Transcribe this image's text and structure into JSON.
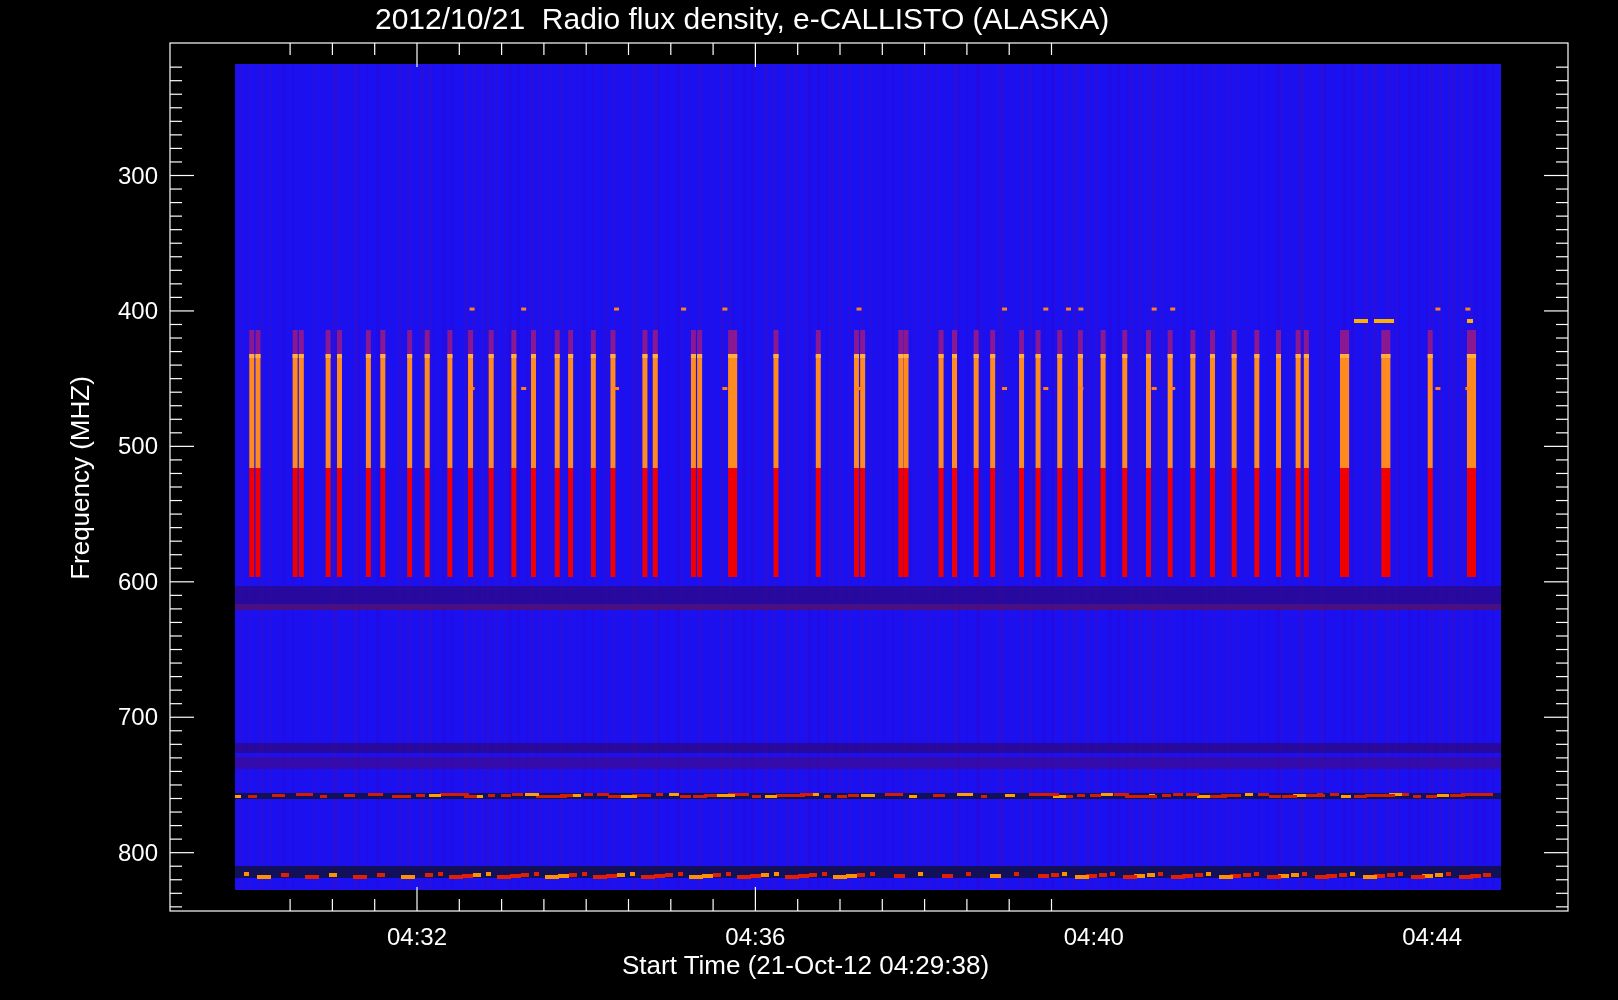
{
  "title": "2012/10/21  Radio flux density, e-CALLISTO (ALASKA)",
  "y_axis": {
    "label": "Frequency (MHZ)",
    "tick_labels": [
      "300",
      "400",
      "500",
      "600",
      "700",
      "800"
    ]
  },
  "x_axis": {
    "label": "Start Time (21-Oct-12 04:29:38)",
    "tick_labels": [
      "04:32",
      "04:36",
      "04:40",
      "04:44"
    ]
  }
}
